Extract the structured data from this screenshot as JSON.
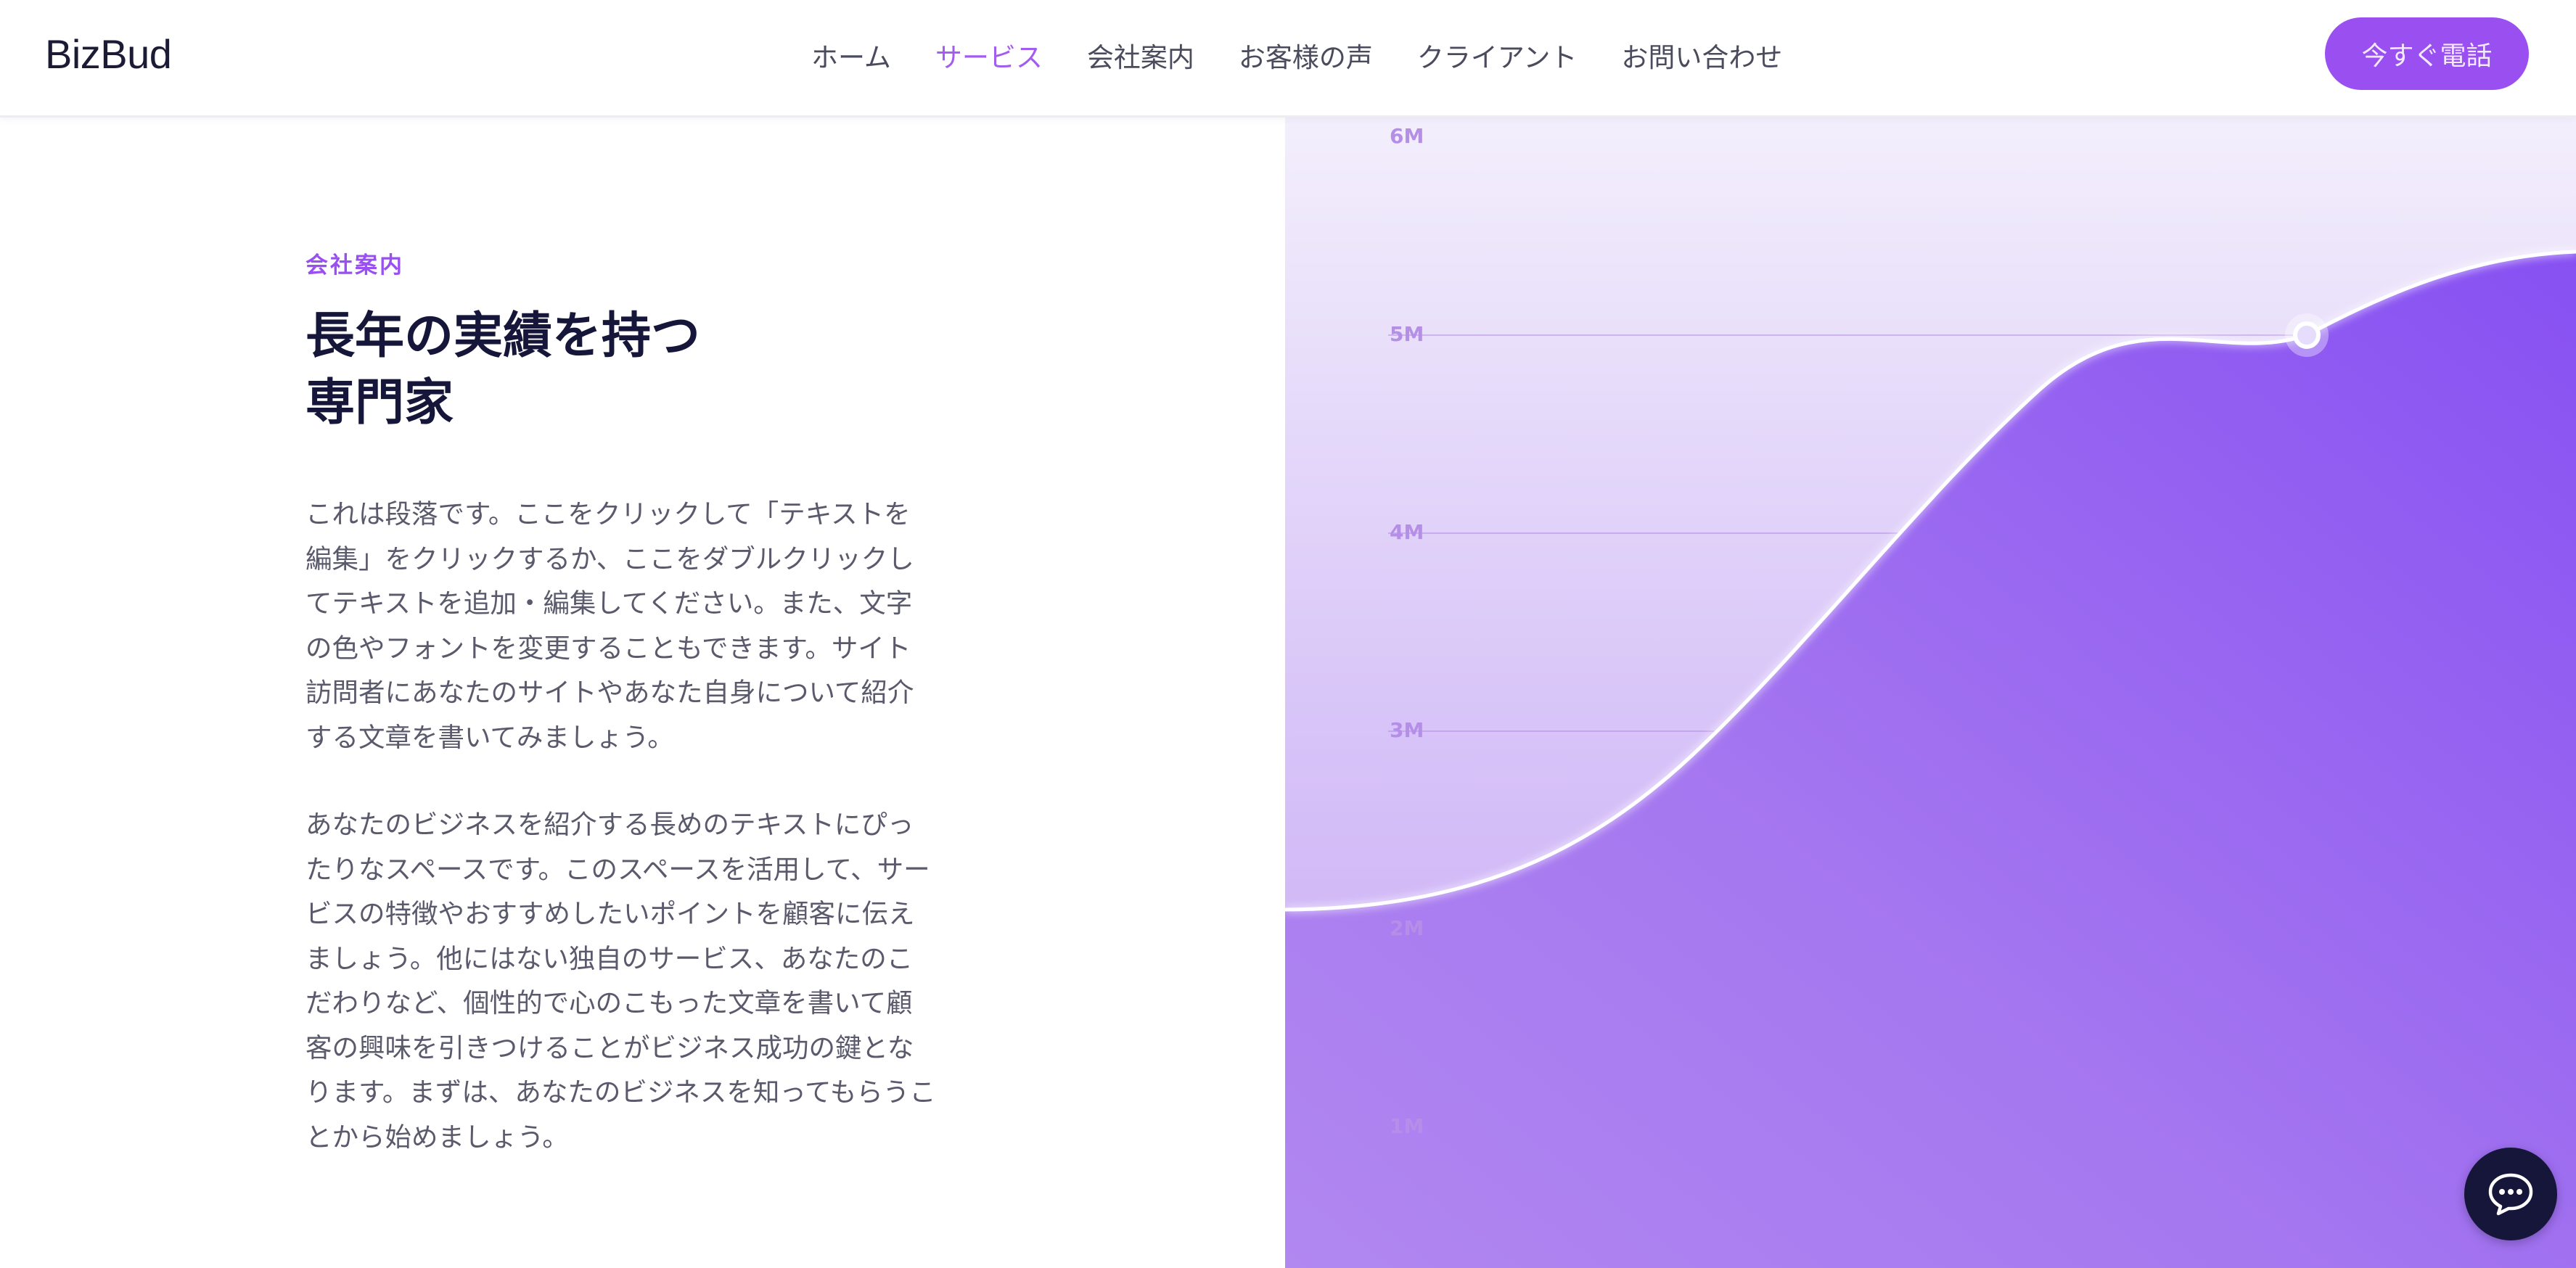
{
  "header": {
    "logo": "BizBud",
    "nav": [
      {
        "label": "ホーム",
        "active": false
      },
      {
        "label": "サービス",
        "active": true
      },
      {
        "label": "会社案内",
        "active": false
      },
      {
        "label": "お客様の声",
        "active": false
      },
      {
        "label": "クライアント",
        "active": false
      },
      {
        "label": "お問い合わせ",
        "active": false
      }
    ],
    "cta_label": "今すぐ電話"
  },
  "about": {
    "eyebrow": "会社案内",
    "headline_line1": "長年の実績を持つ",
    "headline_line2": "専門家",
    "paragraph1": "これは段落です。ここをクリックして「テキストを編集」をクリックするか、ここをダブルクリックしてテキストを追加・編集してください。また、文字の色やフォントを変更することもできます。サイト訪問者にあなたのサイトやあなた自身について紹介する文章を書いてみましょう。",
    "paragraph2": "あなたのビジネスを紹介する長めのテキストにぴったりなスペースです。このスペースを活用して、サービスの特徴やおすすめしたいポイントを顧客に伝えましょう。他にはない独自のサービス、あなたのこだわりなど、個性的で心のこもった文章を書いて顧客の興味を引きつけることがビジネス成功の鍵となります。まずは、あなたのビジネスを知ってもらうことから始めましょう。"
  },
  "chart_data": {
    "type": "area",
    "title": "",
    "xlabel": "",
    "ylabel": "",
    "y_ticks": [
      "6M",
      "5M",
      "4M",
      "3M",
      "2M",
      "1M"
    ],
    "ylim": [
      0,
      6000000
    ],
    "grid": true,
    "legend": "none",
    "highlight_point": {
      "y": 5000000
    },
    "colors": {
      "fill": "#8a52f0",
      "line": "#ffffff",
      "background_top": "#f1ecfc"
    }
  },
  "colors": {
    "accent": "#9a4ff0",
    "heading": "#16163a",
    "body_text": "#5a5a6c",
    "chat_button": "#15163a"
  },
  "icons": {
    "chat": "chat-bubble-icon"
  }
}
